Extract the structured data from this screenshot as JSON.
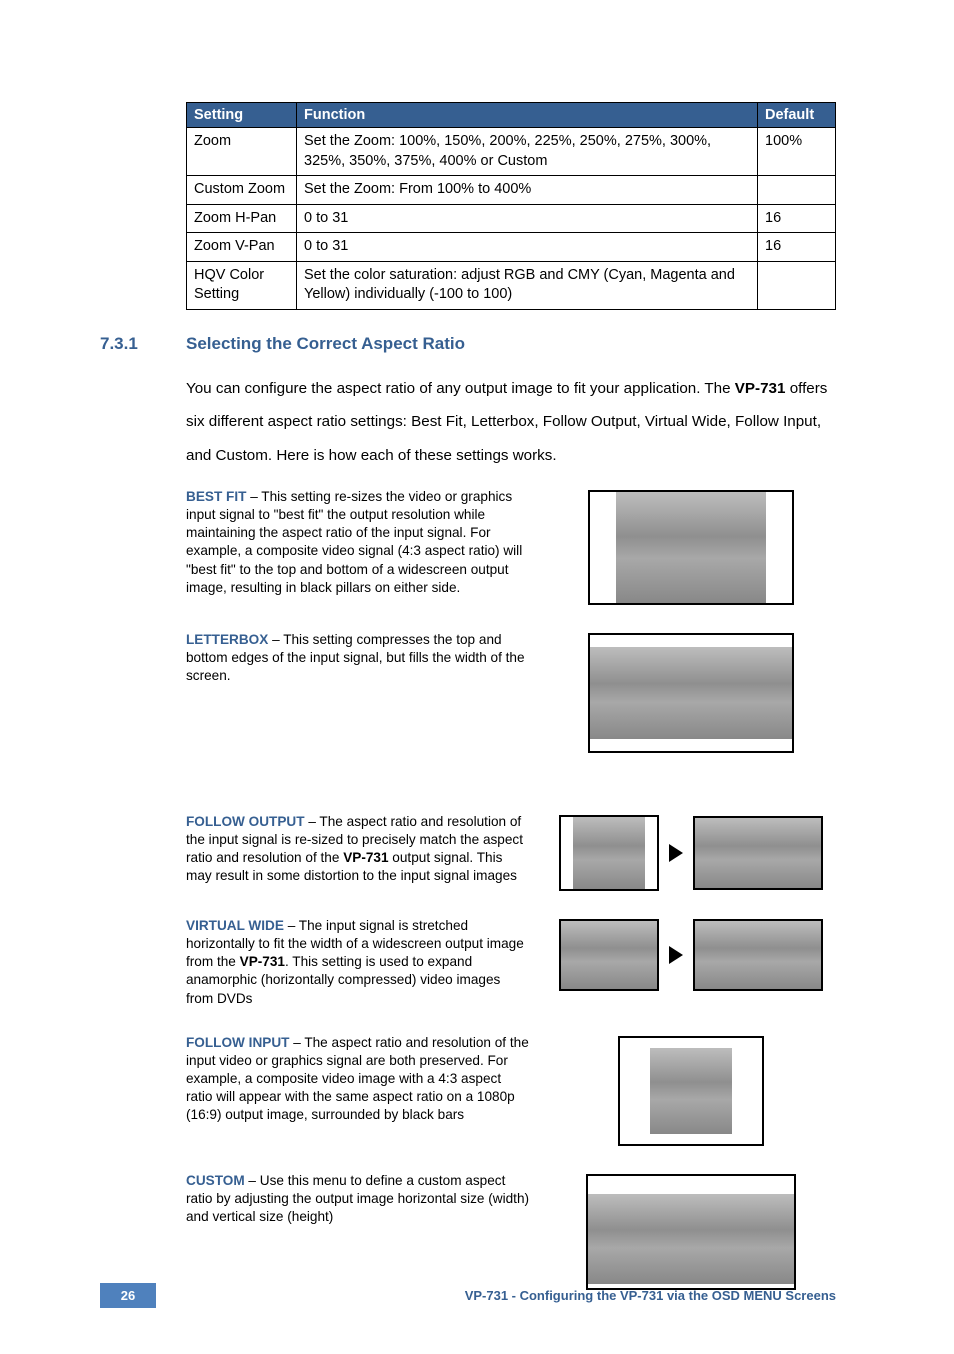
{
  "table": {
    "headers": {
      "setting": "Setting",
      "function": "Function",
      "default": "Default"
    },
    "rows": [
      {
        "setting": "Zoom",
        "function": "Set the Zoom: 100%, 150%, 200%, 225%, 250%, 275%, 300%, 325%, 350%, 375%, 400% or Custom",
        "default": "100%"
      },
      {
        "setting": "Custom Zoom",
        "function": "Set the Zoom: From 100% to 400%",
        "default": ""
      },
      {
        "setting": "Zoom H-Pan",
        "function": "0 to 31",
        "default": "16"
      },
      {
        "setting": "Zoom V-Pan",
        "function": "0 to 31",
        "default": "16"
      },
      {
        "setting": "HQV Color Setting",
        "function": "Set the color saturation: adjust RGB and CMY (Cyan, Magenta and Yellow) individually (-100 to 100)",
        "default": ""
      }
    ]
  },
  "section": {
    "num": "7.3.1",
    "title": "Selecting the Correct Aspect Ratio"
  },
  "intro": {
    "line1a": "You can configure the aspect ratio of any output image to fit your application. The ",
    "product": "VP-731",
    "line1b": " offers six different aspect ratio settings: Best Fit, Letterbox, Follow Output, Virtual Wide, Follow Input, and Custom. Here is how each of these settings works."
  },
  "items": [
    {
      "label": "BEST FIT",
      "text": " – This setting re-sizes the video or graphics input signal to \"best fit\" the output resolution while maintaining the aspect ratio of the input signal. For example, a composite video signal (4:3 aspect ratio) will \"best fit\" to the top and bottom of a widescreen output image, resulting in black pillars on either side."
    },
    {
      "label": "LETTERBOX",
      "text": " – This setting compresses the top and bottom edges of the input signal, but fills the width of the screen."
    },
    {
      "label": "FOLLOW OUTPUT",
      "pre": " – The aspect ratio and resolution of the input signal is re-sized to precisely match the aspect ratio and resolution of the ",
      "bold": "VP-731",
      "post": " output signal. This may result in some distortion to the input signal images"
    },
    {
      "label": "VIRTUAL WIDE",
      "pre": " – The input signal is stretched horizontally to fit the width of a widescreen output image from the ",
      "bold": "VP-731",
      "post": ". This setting is used to expand anamorphic (horizontally compressed) video images from DVDs"
    },
    {
      "label": "FOLLOW INPUT",
      "text": " – The aspect ratio and resolution of the input video or graphics signal are both preserved. For example, a composite video image with a 4:3 aspect ratio will appear with the same aspect ratio on a 1080p (16:9) output image, surrounded by black bars"
    },
    {
      "label": "CUSTOM",
      "text": " – Use this menu to define a custom aspect ratio by adjusting the output image horizontal size (width) and vertical size (height)"
    }
  ],
  "footer": {
    "pagenum": "26",
    "text": "VP-731 - Configuring the VP-731 via the OSD MENU Screens"
  }
}
